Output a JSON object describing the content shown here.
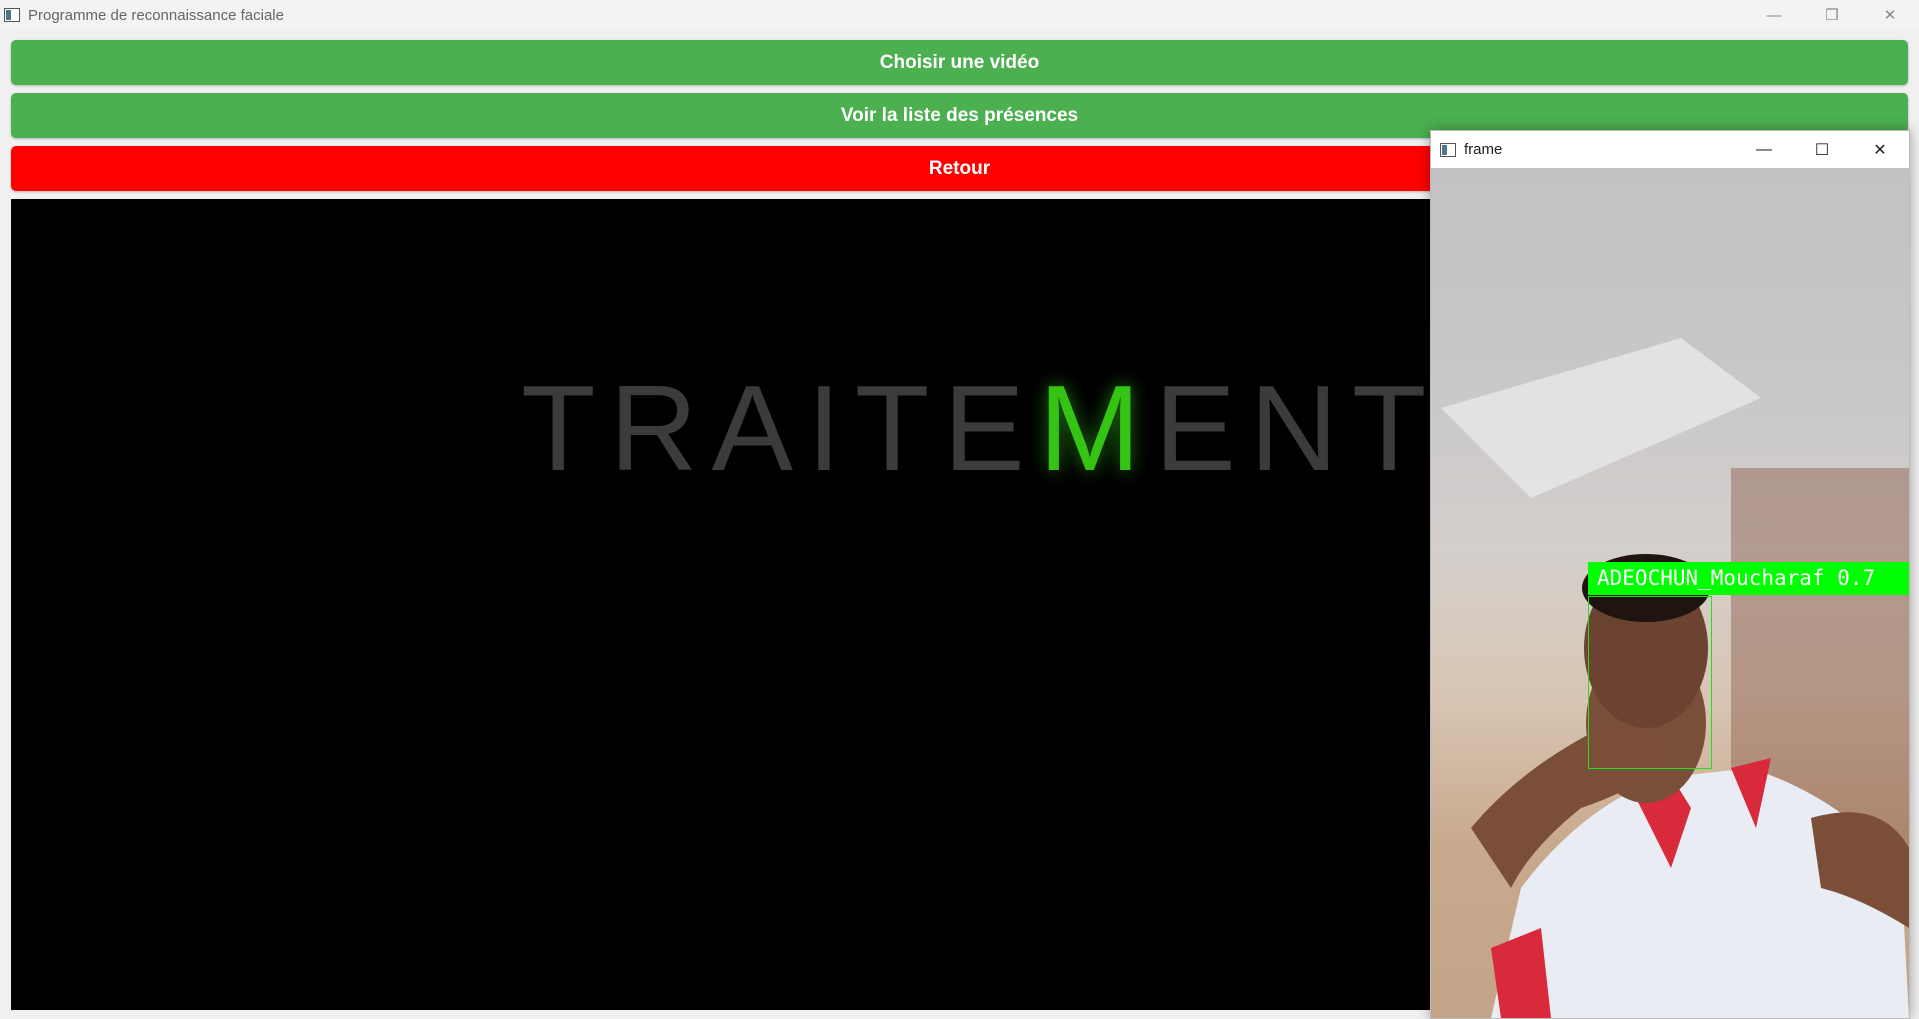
{
  "window": {
    "title": "Programme de reconnaissance faciale",
    "controls": {
      "minimize": "—",
      "restore": "❐",
      "close": "✕"
    }
  },
  "buttons": {
    "choose_video": "Choisir une vidéo",
    "attendance_list": "Voir la liste des présences",
    "back": "Retour"
  },
  "colors": {
    "green_button": "#4caf50",
    "red_button": "#ff0000",
    "highlight_letter": "#36c414",
    "detection_box": "#00ff00"
  },
  "video": {
    "text_before": "TRAITE",
    "text_highlight": "M",
    "text_after": "ENT"
  },
  "frame_window": {
    "title": "frame",
    "controls": {
      "minimize": "—",
      "maximize": "☐",
      "close": "✕"
    },
    "detection_label": "ADEOCHUN_Moucharaf 0.7"
  },
  "icons": [
    "app-window-icon",
    "minimize-icon",
    "restore-icon",
    "maximize-icon",
    "close-icon"
  ]
}
